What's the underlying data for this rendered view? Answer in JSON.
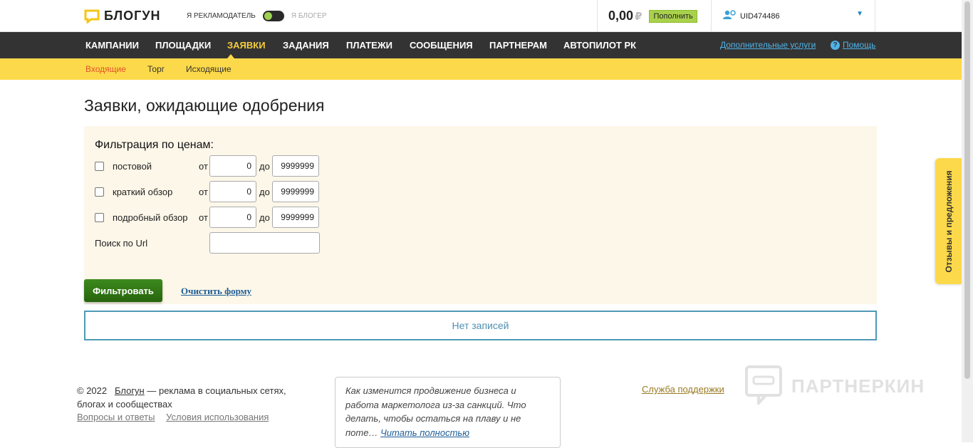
{
  "header": {
    "logo_text": "БЛОГУН",
    "role_advertiser": "Я РЕКЛАМОДАТЕЛЬ",
    "role_blogger": "Я БЛОГЕР",
    "balance": "0,00",
    "currency": "₽",
    "topup_label": "Пополнить",
    "user_id": "UID474486",
    "accent": "#fcd94a"
  },
  "nav": {
    "items": [
      "КАМПАНИИ",
      "ПЛОЩАДКИ",
      "ЗАЯВКИ",
      "ЗАДАНИЯ",
      "ПЛАТЕЖИ",
      "СООБЩЕНИЯ",
      "ПАРТНЕРАМ",
      "АВТОПИЛОТ РК"
    ],
    "active": "ЗАЯВКИ",
    "extra_services": "Дополнительные услуги",
    "help": "Помощь"
  },
  "subnav": {
    "items": [
      "Входящие",
      "Торг",
      "Исходящие"
    ],
    "active": "Входящие"
  },
  "main": {
    "title": "Заявки, ожидающие одобрения",
    "filter": {
      "heading": "Фильтрация по ценам:",
      "from_label": "от",
      "to_label": "до",
      "rows": [
        {
          "label": "постовой",
          "from": "0",
          "to": "9999999"
        },
        {
          "label": "краткий обзор",
          "from": "0",
          "to": "9999999"
        },
        {
          "label": "подробный обзор",
          "from": "0",
          "to": "9999999"
        }
      ],
      "url_label": "Поиск по Url",
      "url_value": "",
      "submit_label": "Фильтровать",
      "clear_label": "Очистить форму"
    },
    "no_records": "Нет записей"
  },
  "feedback_tab": "Отзывы и предложения",
  "footer": {
    "copyright": "© 2022",
    "brand": "Блогун",
    "tagline": " — реклама в социальных сетях, блогах и сообществах",
    "faq": "Вопросы и ответы",
    "terms": "Условия использования",
    "article_text": "Как изменится продвижение бизнеса и работа маркетолога из-за санкций. Что делать, чтобы остаться на плаву и не поте…",
    "article_link": "Читать полностью",
    "support": "Служба поддержки",
    "watermark": "ПАРТНЕРКИН"
  }
}
